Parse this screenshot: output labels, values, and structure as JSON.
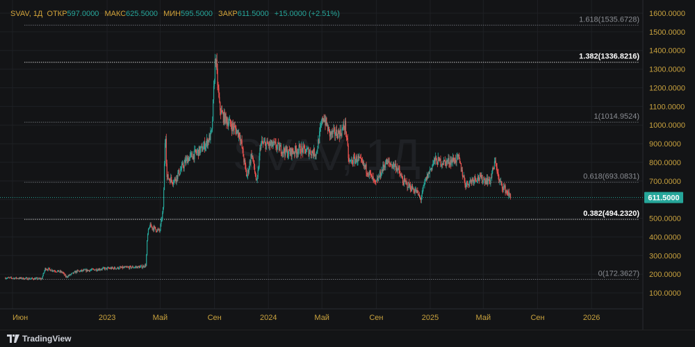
{
  "legend": {
    "symbol": "SVAV, 1Д",
    "open_label": "ОТКР",
    "open": "597.0000",
    "high_label": "МАКС",
    "high": "625.5000",
    "low_label": "МИН",
    "low": "595.5000",
    "close_label": "ЗАКР",
    "close": "611.5000",
    "change": "+15.0000 (+2.51%)"
  },
  "watermark": "SVAV, 1Д",
  "footer": {
    "brand": "TradingView"
  },
  "colors": {
    "up": "#26a69a",
    "down": "#ef5350",
    "axis_text": "#c9a23e",
    "background": "#131416"
  },
  "chart_data": {
    "type": "candlestick",
    "title": "SVAV, 1Д",
    "ylim": [
      50,
      1650
    ],
    "y_ticks": [
      "100.0000",
      "200.0000",
      "300.0000",
      "400.0000",
      "500.0000",
      "600.0000",
      "700.0000",
      "800.0000",
      "900.0000",
      "1000.0000",
      "1100.0000",
      "1200.0000",
      "1300.0000",
      "1400.0000",
      "1500.0000",
      "1600.0000"
    ],
    "y_tick_values": [
      100,
      200,
      300,
      400,
      500,
      600,
      700,
      800,
      900,
      1000,
      1100,
      1200,
      1300,
      1400,
      1500,
      1600
    ],
    "x_ticks": [
      {
        "label": "Июн",
        "day": 0
      },
      {
        "label": "2023",
        "day": 214
      },
      {
        "label": "Май",
        "day": 334
      },
      {
        "label": "Сен",
        "day": 457
      },
      {
        "label": "2024",
        "day": 579
      },
      {
        "label": "Май",
        "day": 700
      },
      {
        "label": "Сен",
        "day": 823
      },
      {
        "label": "2025",
        "day": 945
      },
      {
        "label": "Май",
        "day": 1065
      },
      {
        "label": "Сен",
        "day": 1188
      },
      {
        "label": "2026",
        "day": 1310
      }
    ],
    "last_price": {
      "value": 611.5,
      "label": "611.5000"
    },
    "fib_levels": [
      {
        "label": "1.618(1535.6728)",
        "value": 1535.6728,
        "bold": false
      },
      {
        "label": "1.382(1336.8216)",
        "value": 1336.8216,
        "bold": true
      },
      {
        "label": "1(1014.9524)",
        "value": 1014.9524,
        "bold": false
      },
      {
        "label": "0.618(693.0831)",
        "value": 693.0831,
        "bold": false
      },
      {
        "label": "0.382(494.2320)",
        "value": 494.232,
        "bold": true
      },
      {
        "label": "0(172.3627)",
        "value": 172.3627,
        "bold": false
      }
    ],
    "approx_close_path_days_since_jun_2022": [
      [
        -16,
        180
      ],
      [
        66,
        175
      ],
      [
        74,
        230
      ],
      [
        113,
        210
      ],
      [
        121,
        185
      ],
      [
        145,
        215
      ],
      [
        208,
        230
      ],
      [
        294,
        240
      ],
      [
        302,
        250
      ],
      [
        305,
        400
      ],
      [
        310,
        460
      ],
      [
        333,
        430
      ],
      [
        341,
        550
      ],
      [
        346,
        1000
      ],
      [
        349,
        720
      ],
      [
        365,
        700
      ],
      [
        396,
        820
      ],
      [
        428,
        870
      ],
      [
        443,
        920
      ],
      [
        451,
        960
      ],
      [
        459,
        1380
      ],
      [
        468,
        1100
      ],
      [
        475,
        1050
      ],
      [
        514,
        950
      ],
      [
        530,
        720
      ],
      [
        541,
        850
      ],
      [
        553,
        680
      ],
      [
        561,
        900
      ],
      [
        593,
        890
      ],
      [
        624,
        850
      ],
      [
        648,
        870
      ],
      [
        687,
        850
      ],
      [
        703,
        1050
      ],
      [
        718,
        950
      ],
      [
        742,
        960
      ],
      [
        753,
        1000
      ],
      [
        761,
        800
      ],
      [
        781,
        820
      ],
      [
        805,
        750
      ],
      [
        821,
        680
      ],
      [
        844,
        800
      ],
      [
        868,
        780
      ],
      [
        883,
        700
      ],
      [
        915,
        640
      ],
      [
        923,
        600
      ],
      [
        934,
        700
      ],
      [
        954,
        810
      ],
      [
        978,
        800
      ],
      [
        1009,
        820
      ],
      [
        1025,
        680
      ],
      [
        1048,
        720
      ],
      [
        1080,
        700
      ],
      [
        1093,
        810
      ],
      [
        1100,
        700
      ],
      [
        1116,
        650
      ],
      [
        1127,
        611.5
      ]
    ]
  }
}
